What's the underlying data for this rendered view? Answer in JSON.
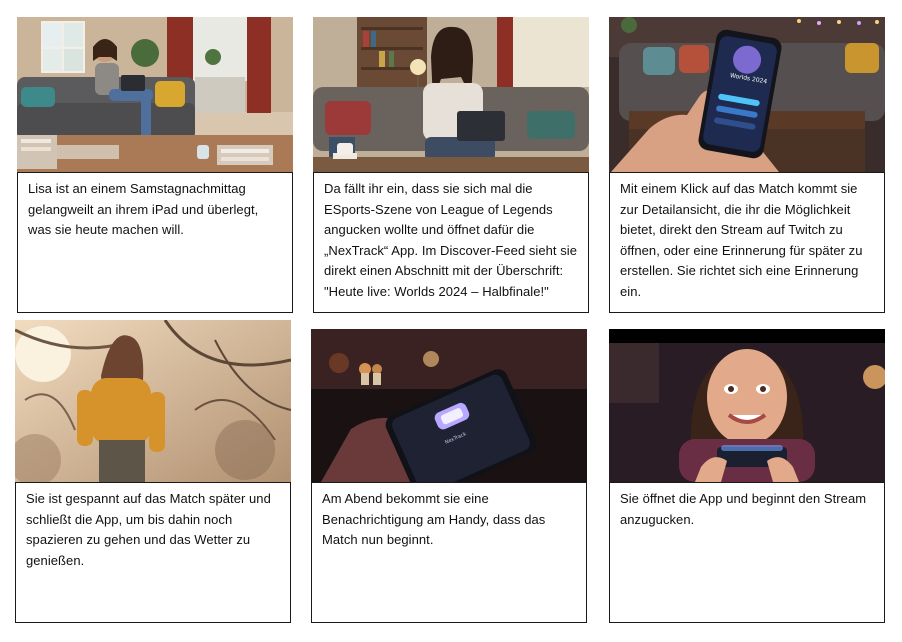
{
  "storyboard": {
    "panels": [
      {
        "caption": "Lisa ist an einem Samstagnachmittag gelangweilt an ihrem iPad und überlegt, was sie heute machen will."
      },
      {
        "caption": "Da fällt ihr ein, dass sie sich mal die ESports-Szene von League of Legends angucken wollte und öffnet dafür die „NexTrack“ App. Im Discover-Feed sieht sie direkt einen Abschnitt mit der Überschrift: \"Heute live: Worlds 2024 – Halbfinale!\""
      },
      {
        "caption": "Mit einem Klick auf das Match kommt sie zur Detailansicht, die ihr die Möglichkeit bietet, direkt den Stream auf Twitch zu öffnen, oder eine Erinnerung für später zu erstellen. Sie richtet sich eine Erinnerung ein.",
        "phone_screen_title": "Worlds 2024"
      },
      {
        "caption": "Sie ist gespannt auf das Match später und schließt die App, um bis dahin noch spazieren zu gehen und das Wetter zu genießen."
      },
      {
        "caption": "Am Abend bekommt sie eine Benachrichtigung am Handy, dass das Match nun beginnt.",
        "phone_screen_title": "NexTrack"
      },
      {
        "caption": "Sie öffnet die App und beginnt den Stream anzugucken."
      }
    ]
  },
  "colors": {
    "border": "#1a1a1a",
    "text": "#111111",
    "background": "#ffffff",
    "app_accent": "#4fc3f7"
  }
}
